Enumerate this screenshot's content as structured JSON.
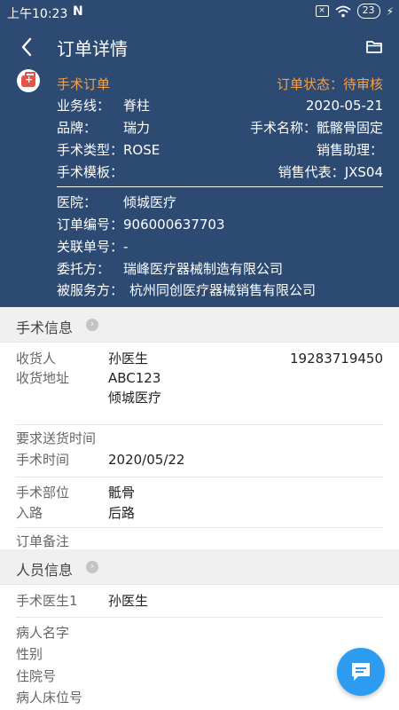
{
  "status": {
    "time": "上午10:23",
    "n": "N",
    "sim": "×",
    "battery": "23"
  },
  "header": {
    "title": "订单详情"
  },
  "order": {
    "type": "手术订单",
    "status_label": "订单状态：",
    "status_value": "待审核",
    "business_line_label": "业务线：",
    "business_line_value": "脊柱",
    "date": "2020-05-21",
    "brand_label": "品牌：",
    "brand_value": "瑞力",
    "surgery_name_label": "手术名称：",
    "surgery_name_value": "骶髂骨固定",
    "surgery_type_label": "手术类型：",
    "surgery_type_value": "ROSE",
    "sales_assistant_label": "销售助理：",
    "sales_assistant_value": "",
    "template_label": "手术模板：",
    "sales_rep_label": "销售代表：",
    "sales_rep_value": "JXS04",
    "hospital_label": "医院：",
    "hospital_value": "倾城医疗",
    "order_no_label": "订单编号：",
    "order_no_value": "906000637703",
    "related_no_label": "关联单号：",
    "related_no_value": "-",
    "principal_label": "委托方：",
    "principal_value": "瑞峰医疗器械制造有限公司",
    "served_label": "被服务方：",
    "served_value": "杭州同创医疗器械销售有限公司"
  },
  "surgery_info": {
    "title": "手术信息",
    "receiver_label": "收货人",
    "receiver_value": "孙医生",
    "receiver_phone": "19283719450",
    "address_label": "收货地址",
    "address_line1": "ABC123",
    "address_line2": "倾城医疗",
    "delivery_time_label": "要求送货时间",
    "surgery_time_label": "手术时间",
    "surgery_time_value": "2020/05/22",
    "site_label": "手术部位",
    "site_value": "骶骨",
    "approach_label": "入路",
    "approach_value": "后路",
    "remark_label": "订单备注"
  },
  "personnel": {
    "title": "人员信息",
    "doctor_label": "手术医生1",
    "doctor_value": "孙医生",
    "patient_name_label": "病人名字",
    "gender_label": "性别",
    "admission_label": "住院号",
    "bed_label": "病人床位号"
  },
  "colors": {
    "header_bg": "#2d4a73",
    "accent_orange": "#f5a04a",
    "fab": "#2d9cf0"
  }
}
